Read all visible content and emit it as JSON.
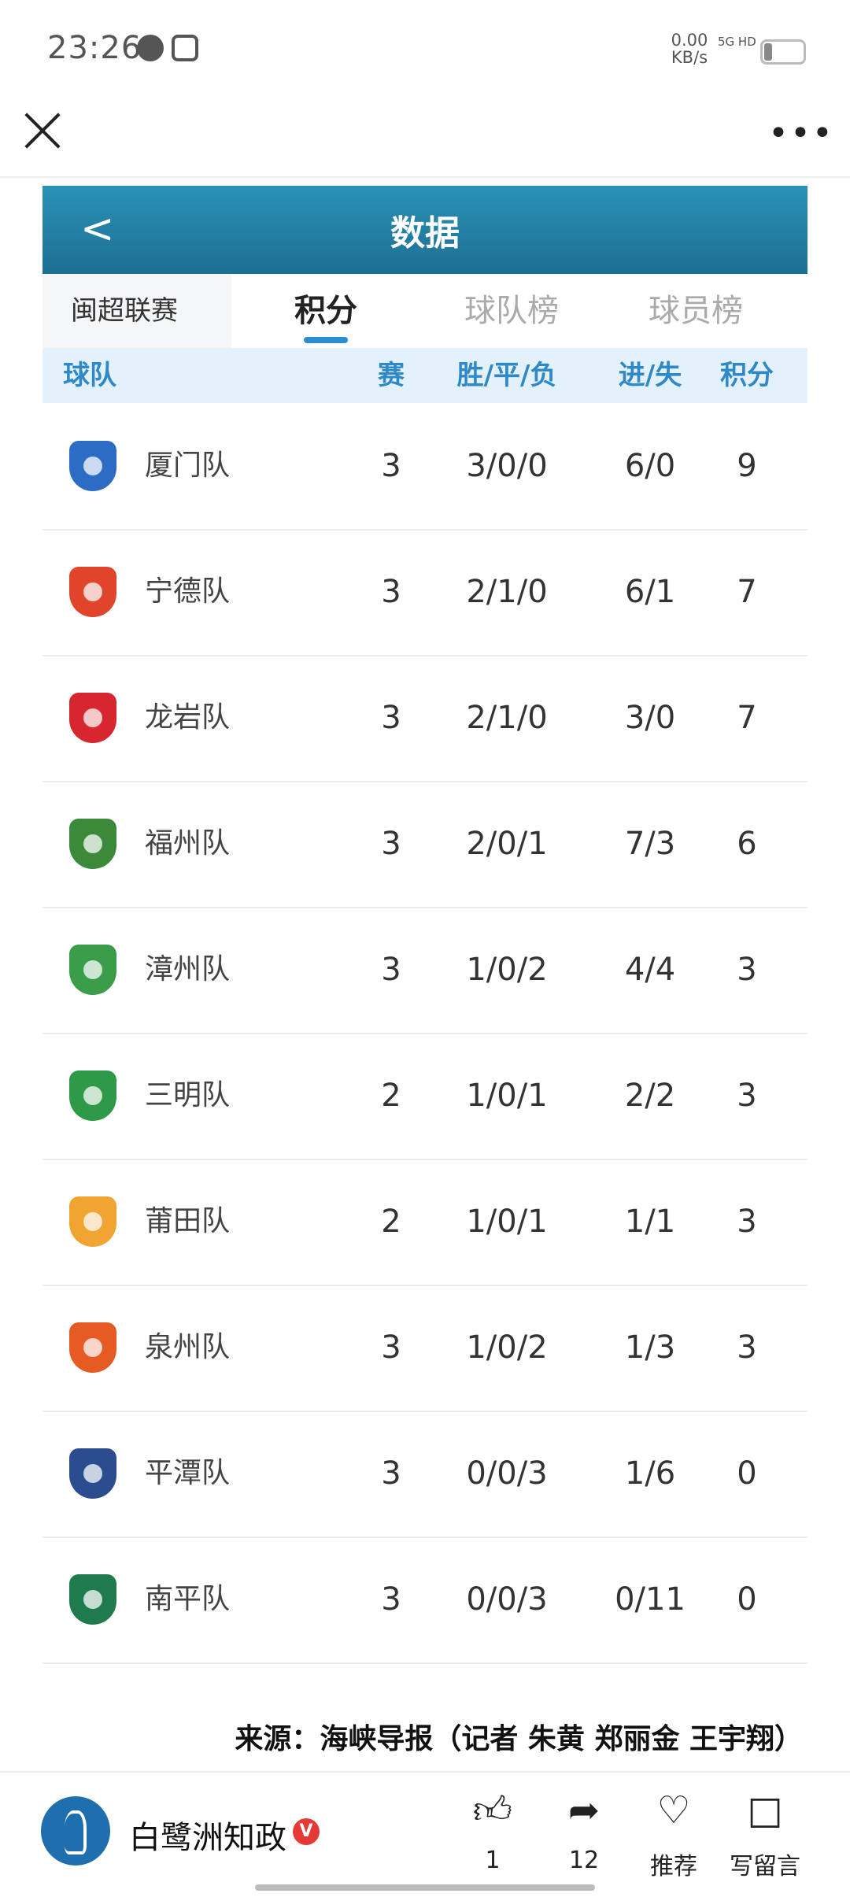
{
  "status_bar": {
    "time": "23:26",
    "net_speed_value": "0.00",
    "net_speed_unit": "KB/s",
    "signal": "5G HD"
  },
  "header": {
    "title": "数据"
  },
  "tabs": {
    "league": "闽超联赛",
    "points": "积分",
    "team_rank": "球队榜",
    "player_rank": "球员榜"
  },
  "columns": {
    "team": "球队",
    "played": "赛",
    "wdl": "胜/平/负",
    "goals": "进/失",
    "points": "积分"
  },
  "rows": [
    {
      "team": "厦门队",
      "played": "3",
      "wdl": "3/0/0",
      "goals": "6/0",
      "points": "9",
      "color": "#2d6cc4"
    },
    {
      "team": "宁德队",
      "played": "3",
      "wdl": "2/1/0",
      "goals": "6/1",
      "points": "7",
      "color": "#e0452b"
    },
    {
      "team": "龙岩队",
      "played": "3",
      "wdl": "2/1/0",
      "goals": "3/0",
      "points": "7",
      "color": "#d7262f"
    },
    {
      "team": "福州队",
      "played": "3",
      "wdl": "2/0/1",
      "goals": "7/3",
      "points": "6",
      "color": "#3b8a3a"
    },
    {
      "team": "漳州队",
      "played": "3",
      "wdl": "1/0/2",
      "goals": "4/4",
      "points": "3",
      "color": "#3a9d4a"
    },
    {
      "team": "三明队",
      "played": "2",
      "wdl": "1/0/1",
      "goals": "2/2",
      "points": "3",
      "color": "#2e9a47"
    },
    {
      "team": "莆田队",
      "played": "2",
      "wdl": "1/0/1",
      "goals": "1/1",
      "points": "3",
      "color": "#f0a431"
    },
    {
      "team": "泉州队",
      "played": "3",
      "wdl": "1/0/2",
      "goals": "1/3",
      "points": "3",
      "color": "#e65a23"
    },
    {
      "team": "平潭队",
      "played": "3",
      "wdl": "0/0/3",
      "goals": "1/6",
      "points": "0",
      "color": "#2b4d8f"
    },
    {
      "team": "南平队",
      "played": "3",
      "wdl": "0/0/3",
      "goals": "0/11",
      "points": "0",
      "color": "#1f7a4c"
    }
  ],
  "source_text": "来源：海峡导报（记者 朱黄 郑丽金 王宇翔）",
  "author": {
    "name": "白鹭洲知政",
    "verified_mark": "V"
  },
  "actions": {
    "like_count": "1",
    "share_count": "12",
    "recommend": "推荐",
    "comment": "写留言"
  }
}
